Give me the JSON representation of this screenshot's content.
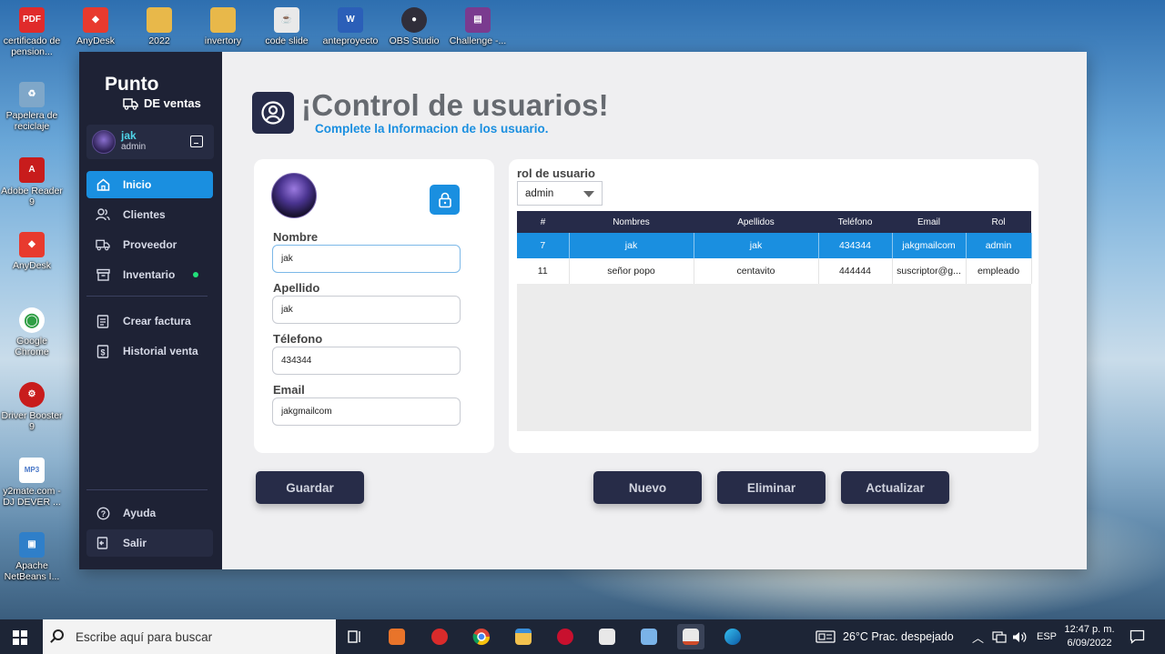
{
  "desktop": {
    "icons": [
      {
        "label": "certificado de pension...",
        "glyph": "PDF",
        "color": "#e02b2b"
      },
      {
        "label": "AnyDesk",
        "glyph": "◆",
        "color": "#e83a2e"
      },
      {
        "label": "2022",
        "glyph": "",
        "color": "#e8b84a"
      },
      {
        "label": "invertory",
        "glyph": "",
        "color": "#e8b84a"
      },
      {
        "label": "code slide",
        "glyph": "☕",
        "color": "#cf4b2a"
      },
      {
        "label": "anteproyecto",
        "glyph": "W",
        "color": "#2b5fb8"
      },
      {
        "label": "OBS Studio",
        "glyph": "●",
        "color": "#302e3a"
      },
      {
        "label": "Challenge -...",
        "glyph": "▤",
        "color": "#7a3b8f"
      },
      {
        "label": "Papelera de reciclaje",
        "glyph": "♻",
        "color": "#7fa7c9"
      },
      {
        "label": "Adobe Reader 9",
        "glyph": "A",
        "color": "#c81c1c"
      },
      {
        "label": "AnyDesk",
        "glyph": "◆",
        "color": "#e83a2e"
      },
      {
        "label": "Google Chrome",
        "glyph": "◉",
        "color": "#2f9e44"
      },
      {
        "label": "Driver Booster 9",
        "glyph": "⚙",
        "color": "#c81c1c"
      },
      {
        "label": "y2mate.com - DJ DEVER ...",
        "glyph": "MP3",
        "color": "#4a78c8"
      },
      {
        "label": "Apache NetBeans I...",
        "glyph": "▣",
        "color": "#2f7fc9"
      }
    ]
  },
  "sidebar": {
    "brand_title": "Punto",
    "brand_subtitle": "DE ventas",
    "user": {
      "name": "jak",
      "role": "admin"
    },
    "items": [
      {
        "label": "Inicio",
        "icon": "home-icon",
        "active": true
      },
      {
        "label": "Clientes",
        "icon": "users-icon"
      },
      {
        "label": "Proveedor",
        "icon": "truck-icon"
      },
      {
        "label": "Inventario",
        "icon": "archive-icon",
        "status": "online"
      },
      {
        "label": "Crear factura",
        "icon": "invoice-icon"
      },
      {
        "label": "Historial venta",
        "icon": "receipt-dollar-icon"
      },
      {
        "label": "Ayuda",
        "icon": "help-circle-icon"
      },
      {
        "label": "Salir",
        "icon": "logout-icon"
      }
    ],
    "colors": {
      "background": "#1e2235",
      "active": "#1a8fe0",
      "status_dot": "#22e07a"
    }
  },
  "main": {
    "title": "¡Control de usuarios!",
    "subtitle": "Complete la Informacion de los usuario.",
    "form": {
      "fields": [
        {
          "label": "Nombre",
          "value": "jak"
        },
        {
          "label": "Apellido",
          "value": "jak"
        },
        {
          "label": "Télefono",
          "value": "434344"
        },
        {
          "label": "Email",
          "value": "jakgmailcom"
        }
      ]
    },
    "role": {
      "label": "rol de usuario",
      "selected": "admin"
    },
    "table": {
      "columns": [
        "#",
        "Nombres",
        "Apellidos",
        "Teléfono",
        "Email",
        "Rol"
      ],
      "rows": [
        [
          "7",
          "jak",
          "jak",
          "434344",
          "jakgmailcom",
          "admin"
        ],
        [
          "11",
          "señor popo",
          "centavito",
          "444444",
          "suscriptor@g...",
          "empleado"
        ]
      ],
      "selected_row": 0
    },
    "buttons": {
      "save": "Guardar",
      "new": "Nuevo",
      "delete": "Eliminar",
      "update": "Actualizar"
    },
    "colors": {
      "accent": "#1a8fe0",
      "dark": "#272c48",
      "title": "#666a70"
    }
  },
  "taskbar": {
    "search_placeholder": "Escribe aquí para buscar",
    "weather": "26°C  Prac. despejado",
    "language": "ESP",
    "time": "12:47 p. m.",
    "date": "6/09/2022"
  }
}
